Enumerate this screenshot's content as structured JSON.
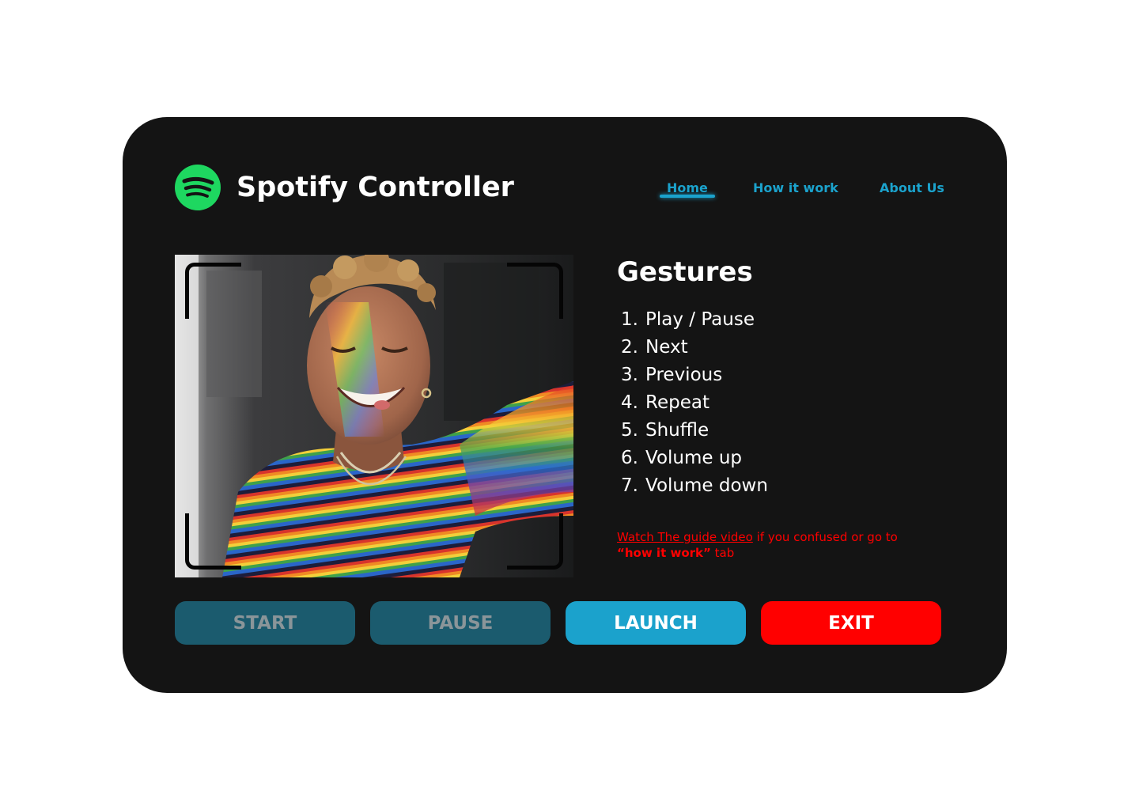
{
  "app": {
    "title": "Spotify Controller",
    "logo_icon": "spotify-logo-icon",
    "brand_color": "#1ED760"
  },
  "nav": {
    "items": [
      {
        "label": "Home",
        "active": true
      },
      {
        "label": "How it work",
        "active": false
      },
      {
        "label": "About Us",
        "active": false
      }
    ],
    "accent_color": "#1BA2CC"
  },
  "camera": {
    "image": "selfie-smiling-person-rainbow-shirt",
    "frame_icon": "camera-frame-corners"
  },
  "gestures": {
    "title": "Gestures",
    "items": [
      {
        "num": "1.",
        "label": "Play / Pause"
      },
      {
        "num": "2.",
        "label": "Next"
      },
      {
        "num": "3.",
        "label": "Previous"
      },
      {
        "num": "4.",
        "label": "Repeat"
      },
      {
        "num": "5.",
        "label": "Shuffle"
      },
      {
        "num": "6.",
        "label": "Volume up"
      },
      {
        "num": "7.",
        "label": "Volume down"
      }
    ]
  },
  "hint": {
    "link_text": "Watch The guide video",
    "middle_text": " if you confused or go to ",
    "tab_name": "“how it work”",
    "suffix": " tab",
    "color": "#FF0000"
  },
  "buttons": {
    "start": "START",
    "pause": "PAUSE",
    "launch": "LAUNCH",
    "exit": "EXIT",
    "disabled_color": "#1B5B6E",
    "launch_color": "#1BA2CC",
    "exit_color": "#FF0000"
  }
}
